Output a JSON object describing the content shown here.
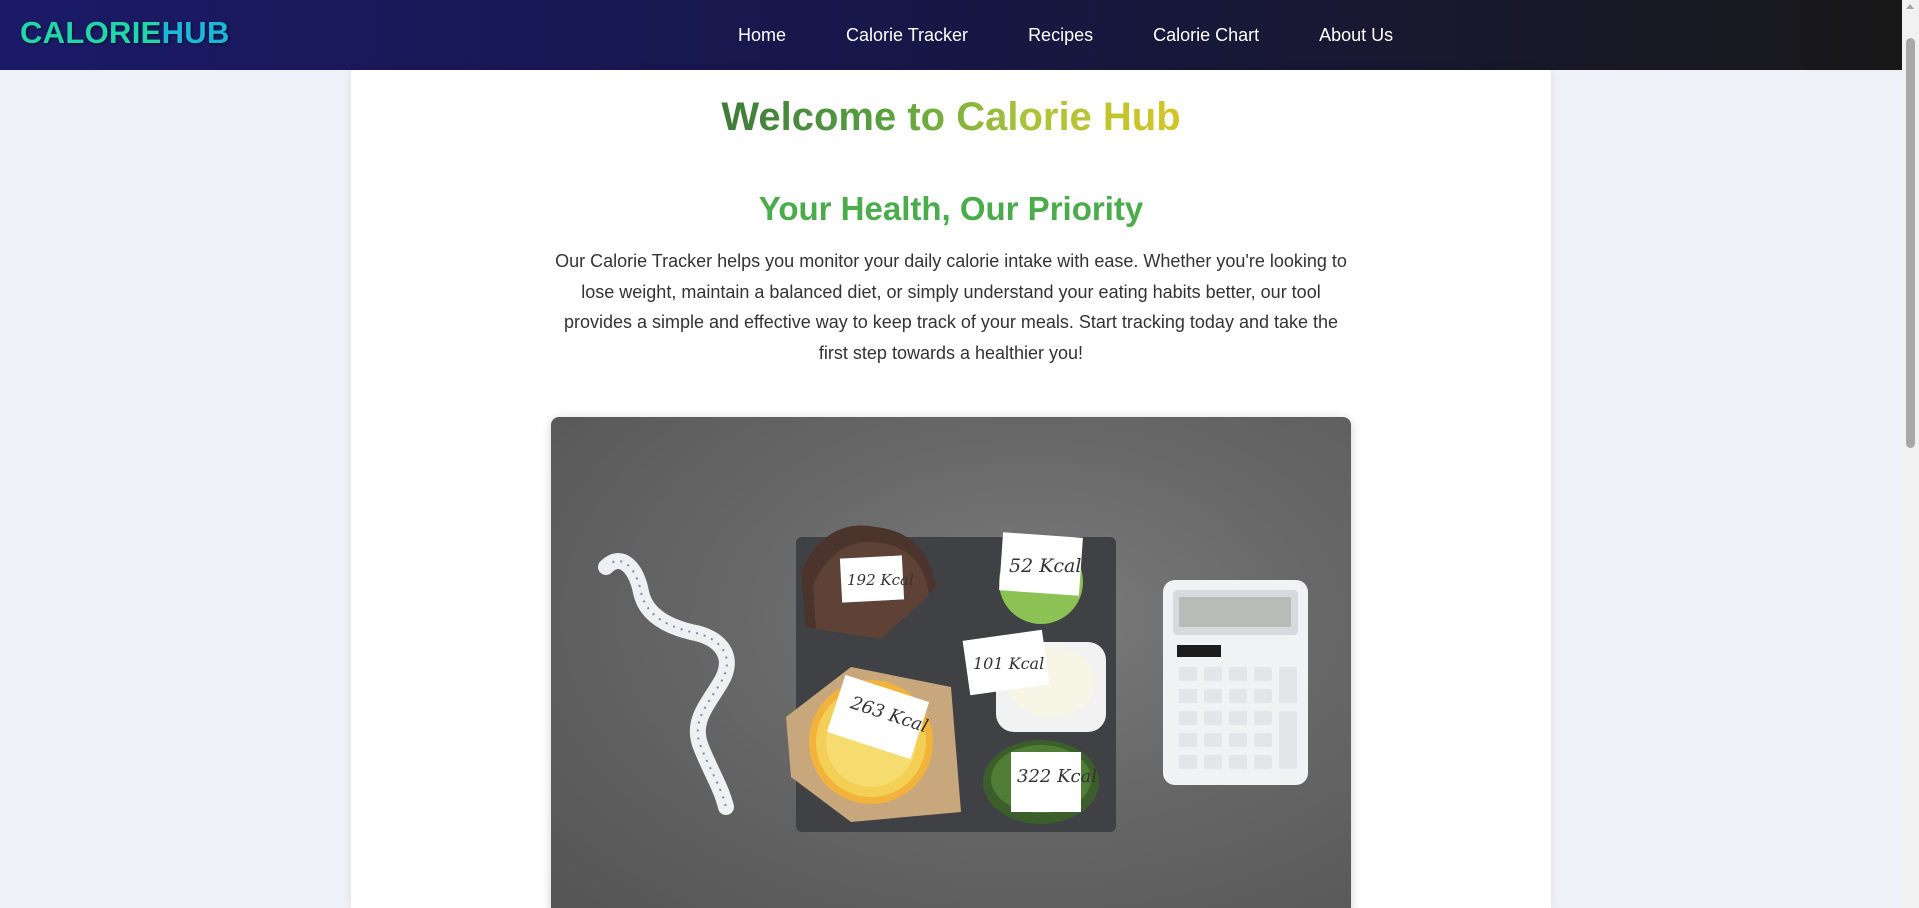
{
  "brand": {
    "part1": "CALORIE",
    "part2": "HUB"
  },
  "nav": {
    "items": [
      {
        "label": "Home"
      },
      {
        "label": "Calorie Tracker"
      },
      {
        "label": "Recipes"
      },
      {
        "label": "Calorie Chart"
      },
      {
        "label": "About Us"
      }
    ]
  },
  "main": {
    "title": "Welcome to Calorie Hub",
    "subtitle": "Your Health, Our Priority",
    "intro": "Our Calorie Tracker helps you monitor your daily calorie intake with ease. Whether you're looking to lose weight, maintain a balanced diet, or simply understand your eating habits better, our tool provides a simple and effective way to keep track of your meals. Start tracking today and take the first step towards a healthier you!",
    "hero_labels": {
      "bread": "192 Kcal",
      "apple": "52 Kcal",
      "yogurt": "101 Kcal",
      "donut": "263 Kcal",
      "avocado": "322 Kcal"
    }
  },
  "colors": {
    "nav_start": "#1b1a68",
    "nav_end": "#181818",
    "brand_calorie": "#1fd7a8",
    "brand_hub": "#1bb8d8",
    "subtitle": "#4aac4a",
    "page_bg": "#eef1f7"
  }
}
